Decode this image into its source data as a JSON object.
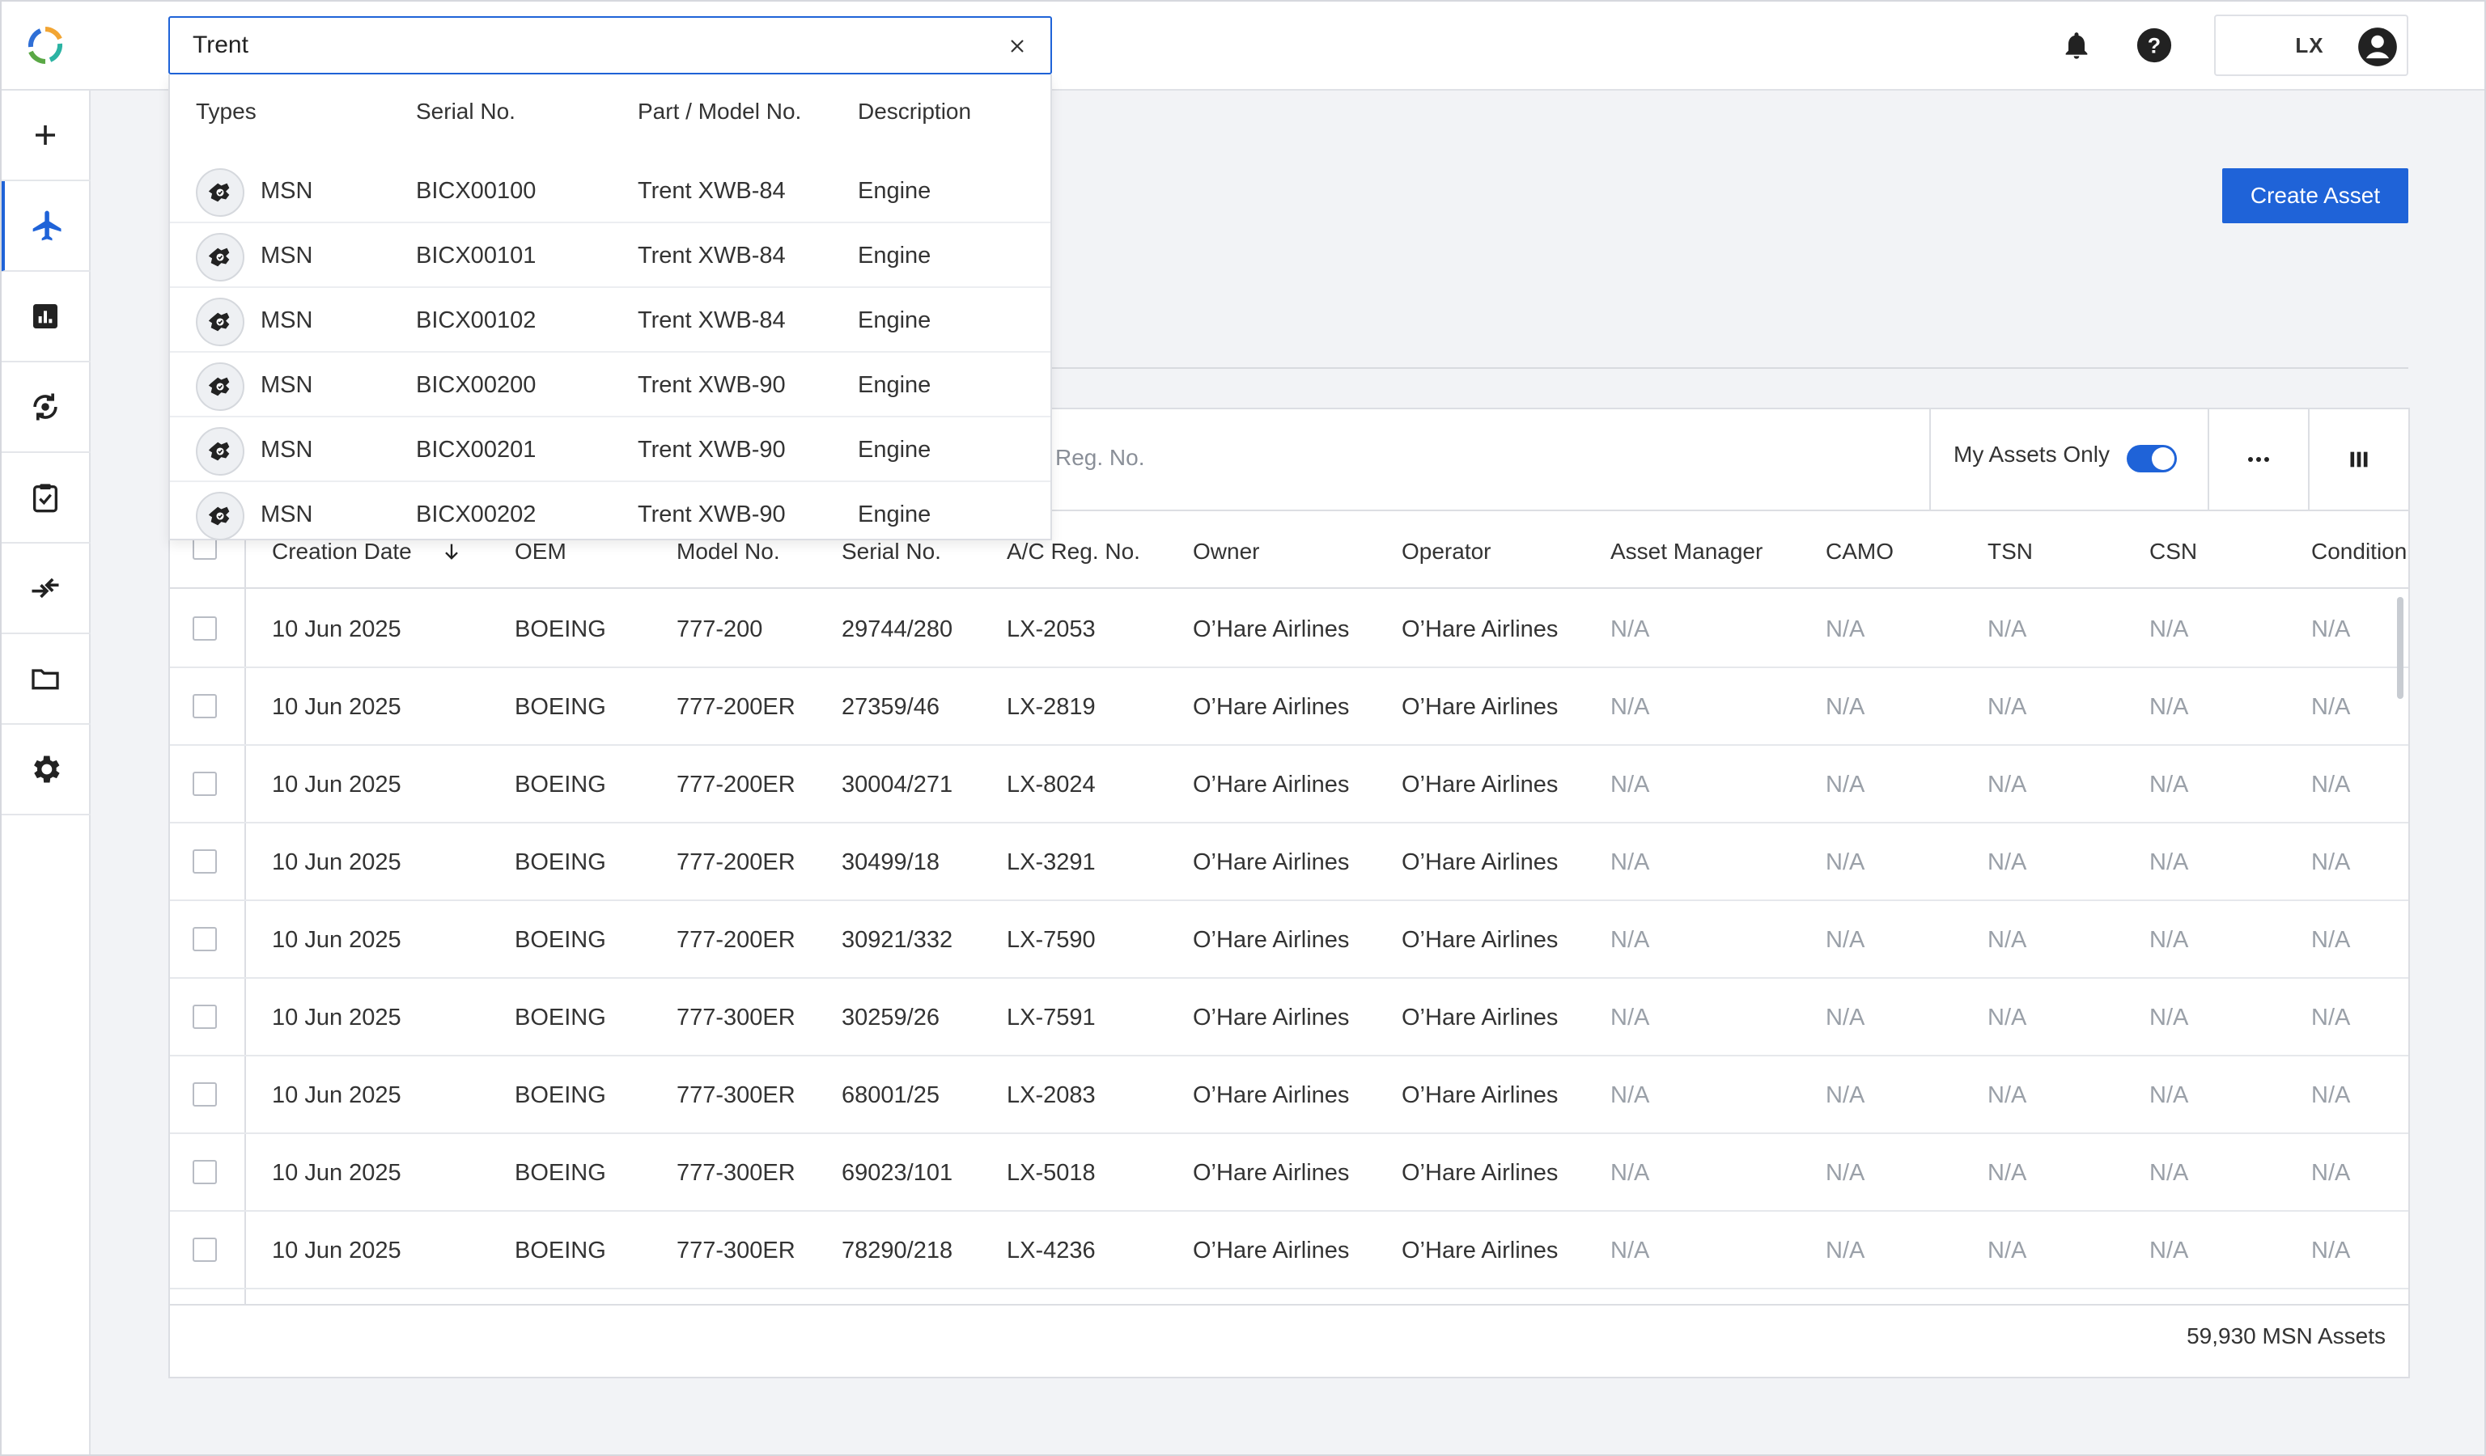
{
  "search": {
    "value": "Trent",
    "placeholder": "Reg. No."
  },
  "dropdown": {
    "headers": [
      "Types",
      "Serial No.",
      "Part / Model No.",
      "Description"
    ],
    "rows": [
      {
        "type": "MSN",
        "serial": "BICX00100",
        "model": "Trent XWB-84",
        "description": "Engine"
      },
      {
        "type": "MSN",
        "serial": "BICX00101",
        "model": "Trent XWB-84",
        "description": "Engine"
      },
      {
        "type": "MSN",
        "serial": "BICX00102",
        "model": "Trent XWB-84",
        "description": "Engine"
      },
      {
        "type": "MSN",
        "serial": "BICX00200",
        "model": "Trent XWB-90",
        "description": "Engine"
      },
      {
        "type": "MSN",
        "serial": "BICX00201",
        "model": "Trent XWB-90",
        "description": "Engine"
      },
      {
        "type": "MSN",
        "serial": "BICX00202",
        "model": "Trent XWB-90",
        "description": "Engine"
      }
    ]
  },
  "header": {
    "user_initials": "LX"
  },
  "sidebar": {
    "items": [
      {
        "name": "add",
        "icon": "plus-icon"
      },
      {
        "name": "assets",
        "icon": "airplane-icon",
        "active": true
      },
      {
        "name": "reports",
        "icon": "bar-chart-icon"
      },
      {
        "name": "sync",
        "icon": "sync-icon"
      },
      {
        "name": "tasks",
        "icon": "clipboard-check-icon"
      },
      {
        "name": "transfers",
        "icon": "transfer-icon"
      },
      {
        "name": "documents",
        "icon": "folder-icon"
      },
      {
        "name": "settings",
        "icon": "gear-icon"
      }
    ]
  },
  "actions": {
    "create_asset": "Create Asset"
  },
  "toolbar": {
    "search_placeholder": "Reg. No.",
    "my_assets_label": "My Assets Only",
    "my_assets_on": true
  },
  "table": {
    "columns": [
      "Creation Date",
      "OEM",
      "Model No.",
      "Serial No.",
      "A/C Reg. No.",
      "Owner",
      "Operator",
      "Asset Manager",
      "CAMO",
      "TSN",
      "CSN",
      "Condition"
    ],
    "rows": [
      [
        "10 Jun 2025",
        "BOEING",
        "777-200",
        "29744/280",
        "LX-2053",
        "O’Hare Airlines",
        "O’Hare Airlines",
        "N/A",
        "N/A",
        "N/A",
        "N/A",
        "N/A"
      ],
      [
        "10 Jun 2025",
        "BOEING",
        "777-200ER",
        "27359/46",
        "LX-2819",
        "O’Hare Airlines",
        "O’Hare Airlines",
        "N/A",
        "N/A",
        "N/A",
        "N/A",
        "N/A"
      ],
      [
        "10 Jun 2025",
        "BOEING",
        "777-200ER",
        "30004/271",
        "LX-8024",
        "O’Hare Airlines",
        "O’Hare Airlines",
        "N/A",
        "N/A",
        "N/A",
        "N/A",
        "N/A"
      ],
      [
        "10 Jun 2025",
        "BOEING",
        "777-200ER",
        "30499/18",
        "LX-3291",
        "O’Hare Airlines",
        "O’Hare Airlines",
        "N/A",
        "N/A",
        "N/A",
        "N/A",
        "N/A"
      ],
      [
        "10 Jun 2025",
        "BOEING",
        "777-200ER",
        "30921/332",
        "LX-7590",
        "O’Hare Airlines",
        "O’Hare Airlines",
        "N/A",
        "N/A",
        "N/A",
        "N/A",
        "N/A"
      ],
      [
        "10 Jun 2025",
        "BOEING",
        "777-300ER",
        "30259/26",
        "LX-7591",
        "O’Hare Airlines",
        "O’Hare Airlines",
        "N/A",
        "N/A",
        "N/A",
        "N/A",
        "N/A"
      ],
      [
        "10 Jun 2025",
        "BOEING",
        "777-300ER",
        "68001/25",
        "LX-2083",
        "O’Hare Airlines",
        "O’Hare Airlines",
        "N/A",
        "N/A",
        "N/A",
        "N/A",
        "N/A"
      ],
      [
        "10 Jun 2025",
        "BOEING",
        "777-300ER",
        "69023/101",
        "LX-5018",
        "O’Hare Airlines",
        "O’Hare Airlines",
        "N/A",
        "N/A",
        "N/A",
        "N/A",
        "N/A"
      ],
      [
        "10 Jun 2025",
        "BOEING",
        "777-300ER",
        "78290/218",
        "LX-4236",
        "O’Hare Airlines",
        "O’Hare Airlines",
        "N/A",
        "N/A",
        "N/A",
        "N/A",
        "N/A"
      ]
    ],
    "count": "59,930 MSN Assets"
  },
  "colors": {
    "accent": "#1f63d8",
    "background": "#f2f3f6",
    "na_text": "#9aa0a8"
  }
}
